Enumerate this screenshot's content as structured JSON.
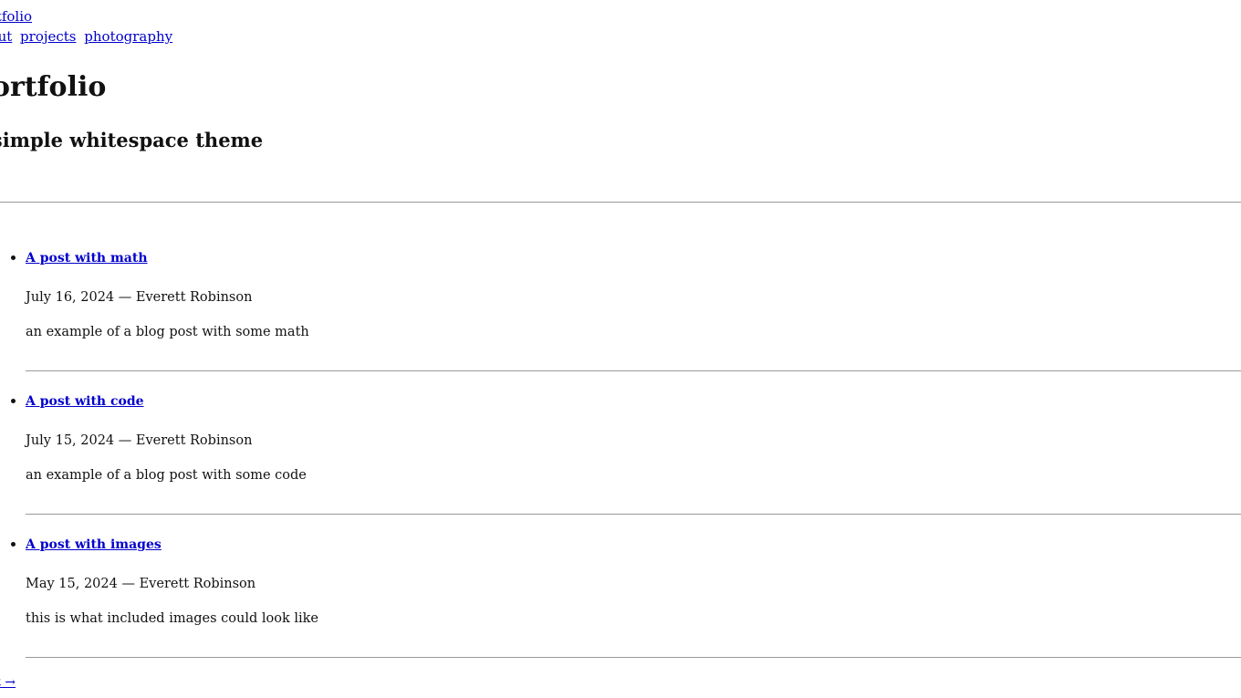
{
  "header": {
    "site_name": "portfolio",
    "nav": [
      {
        "label": "about"
      },
      {
        "label": "projects"
      },
      {
        "label": "photography"
      }
    ]
  },
  "main": {
    "title": "portfolio",
    "subtitle": "a simple whitespace theme"
  },
  "posts": [
    {
      "title": "A post with math",
      "date": "July 16, 2024",
      "author": "Everett Robinson",
      "meta": "July 16, 2024 — Everett Robinson",
      "description": "an example of a blog post with some math"
    },
    {
      "title": "A post with code",
      "date": "July 15, 2024",
      "author": "Everett Robinson",
      "meta": "July 15, 2024 — Everett Robinson",
      "description": "an example of a blog post with some code"
    },
    {
      "title": "A post with images",
      "date": "May 15, 2024",
      "author": "Everett Robinson",
      "meta": "May 15, 2024 — Everett Robinson",
      "description": "this is what included images could look like"
    }
  ],
  "pager": {
    "next_label": "next →"
  }
}
